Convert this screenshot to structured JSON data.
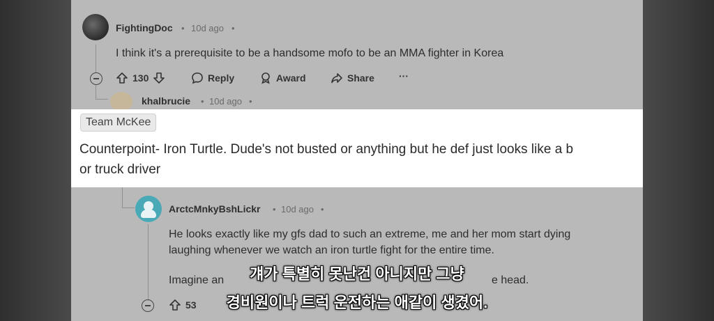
{
  "comments": {
    "fightingdoc": {
      "username": "FightingDoc",
      "time": "10d ago",
      "text": "I think it's a prerequisite to be a handsome mofo to be an MMA fighter in Korea",
      "votes": "130",
      "actions": {
        "reply": "Reply",
        "award": "Award",
        "share": "Share",
        "more": "···"
      }
    },
    "khalbrucie": {
      "username": "khalbrucie",
      "time": "10d ago",
      "flair": "Team McKee",
      "text_line1": "Counterpoint- Iron Turtle. Dude's not busted or anything but he def just looks like a b",
      "text_line2": "or truck driver"
    },
    "arctc": {
      "username": "ArctcMnkyBshLickr",
      "time": "10d ago",
      "text_line1": "He looks exactly like my gfs dad to such an extreme, me and her mom start dying",
      "text_line2": "laughing whenever we watch an iron turtle fight for the entire time.",
      "text_line3_left": "Imagine an",
      "text_line3_right": "e head.",
      "votes_partial": "53"
    }
  },
  "meta_dot": "•",
  "subtitles": {
    "line1": "걔가 특별히 못난건 아니지만 그냥",
    "line2": "경비원이나 트럭 운전하는 애같이 생겼어."
  }
}
